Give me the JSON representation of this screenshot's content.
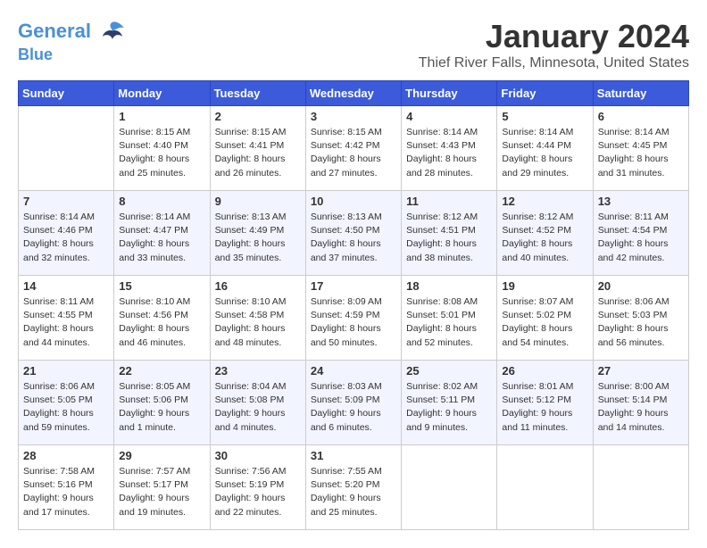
{
  "header": {
    "logo_line1": "General",
    "logo_line2": "Blue",
    "month": "January 2024",
    "location": "Thief River Falls, Minnesota, United States"
  },
  "days_of_week": [
    "Sunday",
    "Monday",
    "Tuesday",
    "Wednesday",
    "Thursday",
    "Friday",
    "Saturday"
  ],
  "weeks": [
    [
      {
        "day": null
      },
      {
        "day": "1",
        "sunrise": "Sunrise: 8:15 AM",
        "sunset": "Sunset: 4:40 PM",
        "daylight": "Daylight: 8 hours and 25 minutes."
      },
      {
        "day": "2",
        "sunrise": "Sunrise: 8:15 AM",
        "sunset": "Sunset: 4:41 PM",
        "daylight": "Daylight: 8 hours and 26 minutes."
      },
      {
        "day": "3",
        "sunrise": "Sunrise: 8:15 AM",
        "sunset": "Sunset: 4:42 PM",
        "daylight": "Daylight: 8 hours and 27 minutes."
      },
      {
        "day": "4",
        "sunrise": "Sunrise: 8:14 AM",
        "sunset": "Sunset: 4:43 PM",
        "daylight": "Daylight: 8 hours and 28 minutes."
      },
      {
        "day": "5",
        "sunrise": "Sunrise: 8:14 AM",
        "sunset": "Sunset: 4:44 PM",
        "daylight": "Daylight: 8 hours and 29 minutes."
      },
      {
        "day": "6",
        "sunrise": "Sunrise: 8:14 AM",
        "sunset": "Sunset: 4:45 PM",
        "daylight": "Daylight: 8 hours and 31 minutes."
      }
    ],
    [
      {
        "day": "7",
        "sunrise": "Sunrise: 8:14 AM",
        "sunset": "Sunset: 4:46 PM",
        "daylight": "Daylight: 8 hours and 32 minutes."
      },
      {
        "day": "8",
        "sunrise": "Sunrise: 8:14 AM",
        "sunset": "Sunset: 4:47 PM",
        "daylight": "Daylight: 8 hours and 33 minutes."
      },
      {
        "day": "9",
        "sunrise": "Sunrise: 8:13 AM",
        "sunset": "Sunset: 4:49 PM",
        "daylight": "Daylight: 8 hours and 35 minutes."
      },
      {
        "day": "10",
        "sunrise": "Sunrise: 8:13 AM",
        "sunset": "Sunset: 4:50 PM",
        "daylight": "Daylight: 8 hours and 37 minutes."
      },
      {
        "day": "11",
        "sunrise": "Sunrise: 8:12 AM",
        "sunset": "Sunset: 4:51 PM",
        "daylight": "Daylight: 8 hours and 38 minutes."
      },
      {
        "day": "12",
        "sunrise": "Sunrise: 8:12 AM",
        "sunset": "Sunset: 4:52 PM",
        "daylight": "Daylight: 8 hours and 40 minutes."
      },
      {
        "day": "13",
        "sunrise": "Sunrise: 8:11 AM",
        "sunset": "Sunset: 4:54 PM",
        "daylight": "Daylight: 8 hours and 42 minutes."
      }
    ],
    [
      {
        "day": "14",
        "sunrise": "Sunrise: 8:11 AM",
        "sunset": "Sunset: 4:55 PM",
        "daylight": "Daylight: 8 hours and 44 minutes."
      },
      {
        "day": "15",
        "sunrise": "Sunrise: 8:10 AM",
        "sunset": "Sunset: 4:56 PM",
        "daylight": "Daylight: 8 hours and 46 minutes."
      },
      {
        "day": "16",
        "sunrise": "Sunrise: 8:10 AM",
        "sunset": "Sunset: 4:58 PM",
        "daylight": "Daylight: 8 hours and 48 minutes."
      },
      {
        "day": "17",
        "sunrise": "Sunrise: 8:09 AM",
        "sunset": "Sunset: 4:59 PM",
        "daylight": "Daylight: 8 hours and 50 minutes."
      },
      {
        "day": "18",
        "sunrise": "Sunrise: 8:08 AM",
        "sunset": "Sunset: 5:01 PM",
        "daylight": "Daylight: 8 hours and 52 minutes."
      },
      {
        "day": "19",
        "sunrise": "Sunrise: 8:07 AM",
        "sunset": "Sunset: 5:02 PM",
        "daylight": "Daylight: 8 hours and 54 minutes."
      },
      {
        "day": "20",
        "sunrise": "Sunrise: 8:06 AM",
        "sunset": "Sunset: 5:03 PM",
        "daylight": "Daylight: 8 hours and 56 minutes."
      }
    ],
    [
      {
        "day": "21",
        "sunrise": "Sunrise: 8:06 AM",
        "sunset": "Sunset: 5:05 PM",
        "daylight": "Daylight: 8 hours and 59 minutes."
      },
      {
        "day": "22",
        "sunrise": "Sunrise: 8:05 AM",
        "sunset": "Sunset: 5:06 PM",
        "daylight": "Daylight: 9 hours and 1 minute."
      },
      {
        "day": "23",
        "sunrise": "Sunrise: 8:04 AM",
        "sunset": "Sunset: 5:08 PM",
        "daylight": "Daylight: 9 hours and 4 minutes."
      },
      {
        "day": "24",
        "sunrise": "Sunrise: 8:03 AM",
        "sunset": "Sunset: 5:09 PM",
        "daylight": "Daylight: 9 hours and 6 minutes."
      },
      {
        "day": "25",
        "sunrise": "Sunrise: 8:02 AM",
        "sunset": "Sunset: 5:11 PM",
        "daylight": "Daylight: 9 hours and 9 minutes."
      },
      {
        "day": "26",
        "sunrise": "Sunrise: 8:01 AM",
        "sunset": "Sunset: 5:12 PM",
        "daylight": "Daylight: 9 hours and 11 minutes."
      },
      {
        "day": "27",
        "sunrise": "Sunrise: 8:00 AM",
        "sunset": "Sunset: 5:14 PM",
        "daylight": "Daylight: 9 hours and 14 minutes."
      }
    ],
    [
      {
        "day": "28",
        "sunrise": "Sunrise: 7:58 AM",
        "sunset": "Sunset: 5:16 PM",
        "daylight": "Daylight: 9 hours and 17 minutes."
      },
      {
        "day": "29",
        "sunrise": "Sunrise: 7:57 AM",
        "sunset": "Sunset: 5:17 PM",
        "daylight": "Daylight: 9 hours and 19 minutes."
      },
      {
        "day": "30",
        "sunrise": "Sunrise: 7:56 AM",
        "sunset": "Sunset: 5:19 PM",
        "daylight": "Daylight: 9 hours and 22 minutes."
      },
      {
        "day": "31",
        "sunrise": "Sunrise: 7:55 AM",
        "sunset": "Sunset: 5:20 PM",
        "daylight": "Daylight: 9 hours and 25 minutes."
      },
      {
        "day": null
      },
      {
        "day": null
      },
      {
        "day": null
      }
    ]
  ]
}
